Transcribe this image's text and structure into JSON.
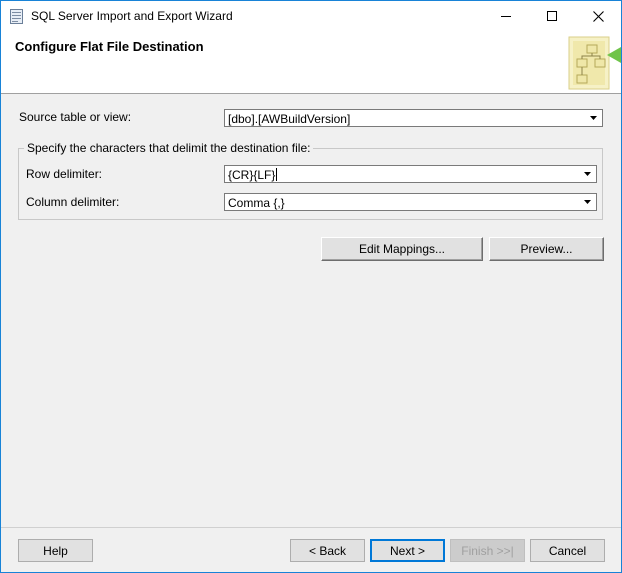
{
  "window": {
    "title": "SQL Server Import and Export Wizard",
    "accent_color": "#1883d7"
  },
  "header": {
    "title": "Configure Flat File Destination",
    "graphic_icon": "wizard-flowchart-icon"
  },
  "form": {
    "source_label": "Source table or view:",
    "source_value": "[dbo].[AWBuildVersion]",
    "group_legend": "Specify the characters that delimit the destination file:",
    "row_delimiter_label": "Row delimiter:",
    "row_delimiter_value": "{CR}{LF}",
    "column_delimiter_label": "Column delimiter:",
    "column_delimiter_value": "Comma {,}"
  },
  "actions": {
    "edit_mappings": "Edit Mappings...",
    "preview": "Preview..."
  },
  "footer": {
    "help": "Help",
    "back": "< Back",
    "next": "Next >",
    "finish": "Finish >>|",
    "cancel": "Cancel"
  }
}
